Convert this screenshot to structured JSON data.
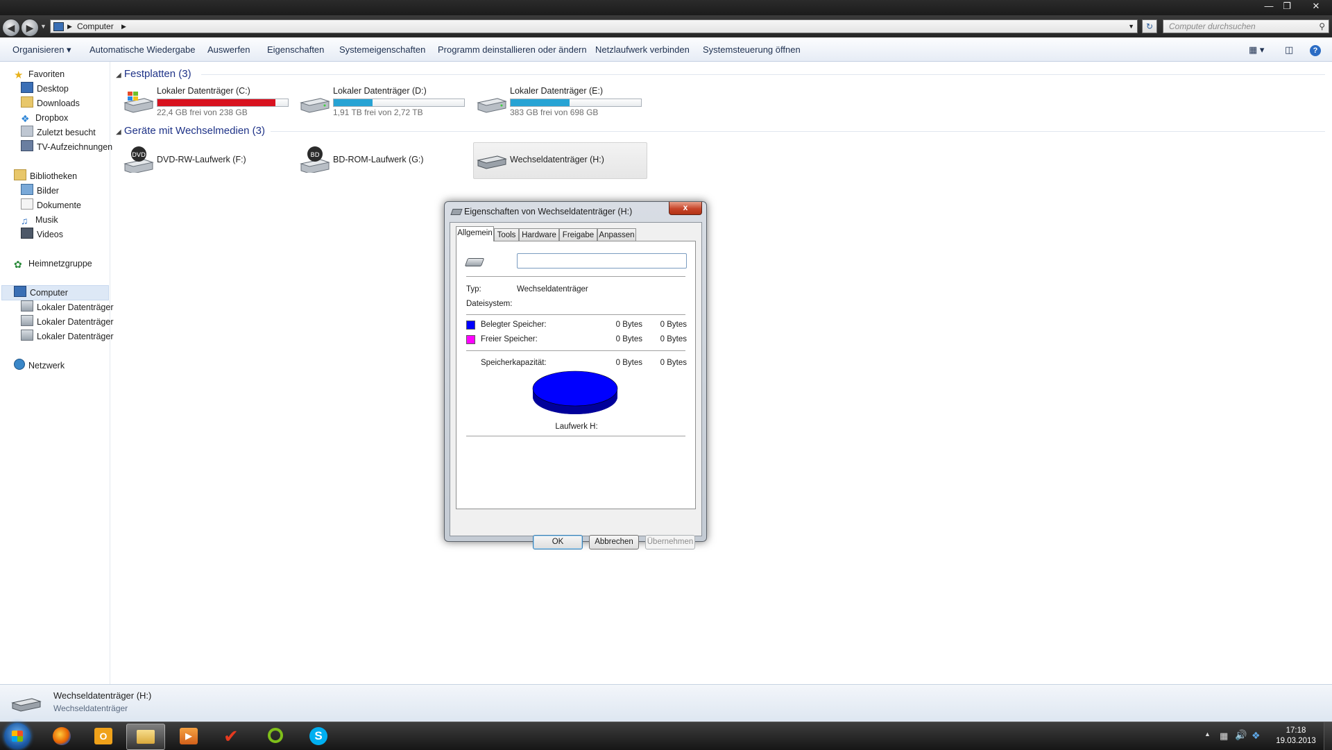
{
  "window": {
    "address_item": "Computer",
    "search_placeholder": "Computer durchsuchen"
  },
  "commands": [
    "Organisieren",
    "Automatische Wiedergabe",
    "Auswerfen",
    "Eigenschaften",
    "Systemeigenschaften",
    "Programm deinstallieren oder ändern",
    "Netzlaufwerk verbinden",
    "Systemsteuerung öffnen"
  ],
  "nav": {
    "favorites": "Favoriten",
    "favorites_items": [
      "Desktop",
      "Downloads",
      "Dropbox",
      "Zuletzt besucht",
      "TV-Aufzeichnungen"
    ],
    "libraries": "Bibliotheken",
    "libraries_items": [
      "Bilder",
      "Dokumente",
      "Musik",
      "Videos"
    ],
    "homegroup": "Heimnetzgruppe",
    "computer": "Computer",
    "computer_items": [
      "Lokaler Datenträger",
      "Lokaler Datenträger",
      "Lokaler Datenträger"
    ],
    "network": "Netzwerk"
  },
  "groups": {
    "hdd_header": "Festplatten (3)",
    "removable_header": "Geräte mit Wechselmedien (3)"
  },
  "hdds": [
    {
      "name": "Lokaler Datenträger (C:)",
      "free": "22,4 GB frei von 238 GB",
      "used_fraction": 0.906,
      "bar_color": "#d8121f"
    },
    {
      "name": "Lokaler Datenträger (D:)",
      "free": "1,91 TB frei von 2,72 TB",
      "used_fraction": 0.298,
      "bar_color": "#27a3d4"
    },
    {
      "name": "Lokaler Datenträger (E:)",
      "free": "383 GB frei von 698 GB",
      "used_fraction": 0.451,
      "bar_color": "#27a3d4"
    }
  ],
  "removables": [
    {
      "name": "DVD-RW-Laufwerk (F:)",
      "badge": "DVD"
    },
    {
      "name": "BD-ROM-Laufwerk (G:)",
      "badge": "BD"
    },
    {
      "name": "Wechseldatenträger (H:)",
      "badge": ""
    }
  ],
  "details": {
    "name": "Wechseldatenträger (H:)",
    "type": "Wechseldatenträger"
  },
  "dialog": {
    "title": "Eigenschaften von Wechseldatenträger (H:)",
    "close": "x",
    "tabs": [
      "Allgemein",
      "Tools",
      "Hardware",
      "Freigabe",
      "Anpassen"
    ],
    "label_value": "",
    "type_label": "Typ:",
    "type_value": "Wechseldatenträger",
    "fs_label": "Dateisystem:",
    "used_label": "Belegter Speicher:",
    "used_bytes": "0 Bytes",
    "used_bytes2": "0 Bytes",
    "free_label": "Freier Speicher:",
    "free_bytes": "0 Bytes",
    "free_bytes2": "0 Bytes",
    "capacity_label": "Speicherkapazität:",
    "capacity_bytes": "0 Bytes",
    "capacity_bytes2": "0 Bytes",
    "drive_label": "Laufwerk H:",
    "used_color": "#0000ff",
    "free_color": "#ff00ff",
    "ok": "OK",
    "cancel": "Abbrechen",
    "apply": "Übernehmen"
  },
  "tray": {
    "time": "17:18",
    "date": "19.03.2013"
  }
}
